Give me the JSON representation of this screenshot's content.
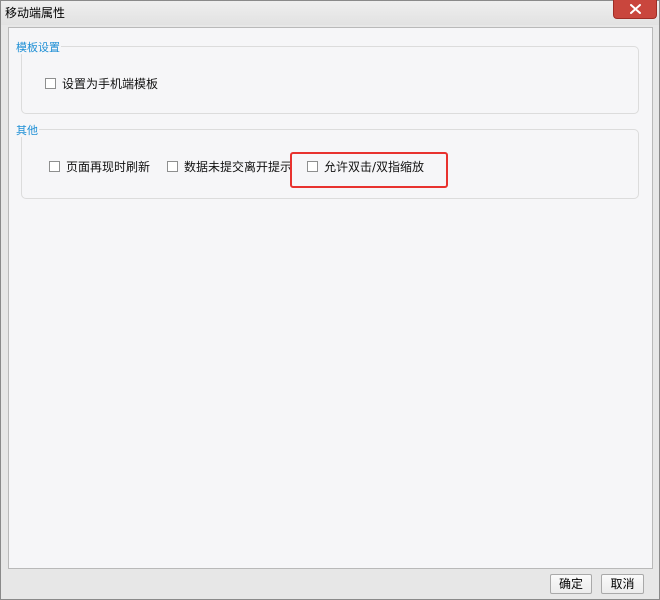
{
  "window": {
    "title": "移动端属性"
  },
  "sections": [
    {
      "legend": "模板设置",
      "checkboxes": [
        {
          "label": "设置为手机端模板",
          "checked": false
        }
      ]
    },
    {
      "legend": "其他",
      "checkboxes": [
        {
          "label": "页面再现时刷新",
          "checked": false
        },
        {
          "label": "数据未提交离开提示",
          "checked": false
        },
        {
          "label": "允许双击/双指缩放",
          "checked": false
        }
      ]
    }
  ],
  "footer": {
    "ok_label": "确定",
    "cancel_label": "取消"
  },
  "colors": {
    "legend": "#1e8fd5",
    "highlight": "#e8322e",
    "close_button": "#c9463d"
  },
  "icons": {
    "close": "close-icon"
  }
}
